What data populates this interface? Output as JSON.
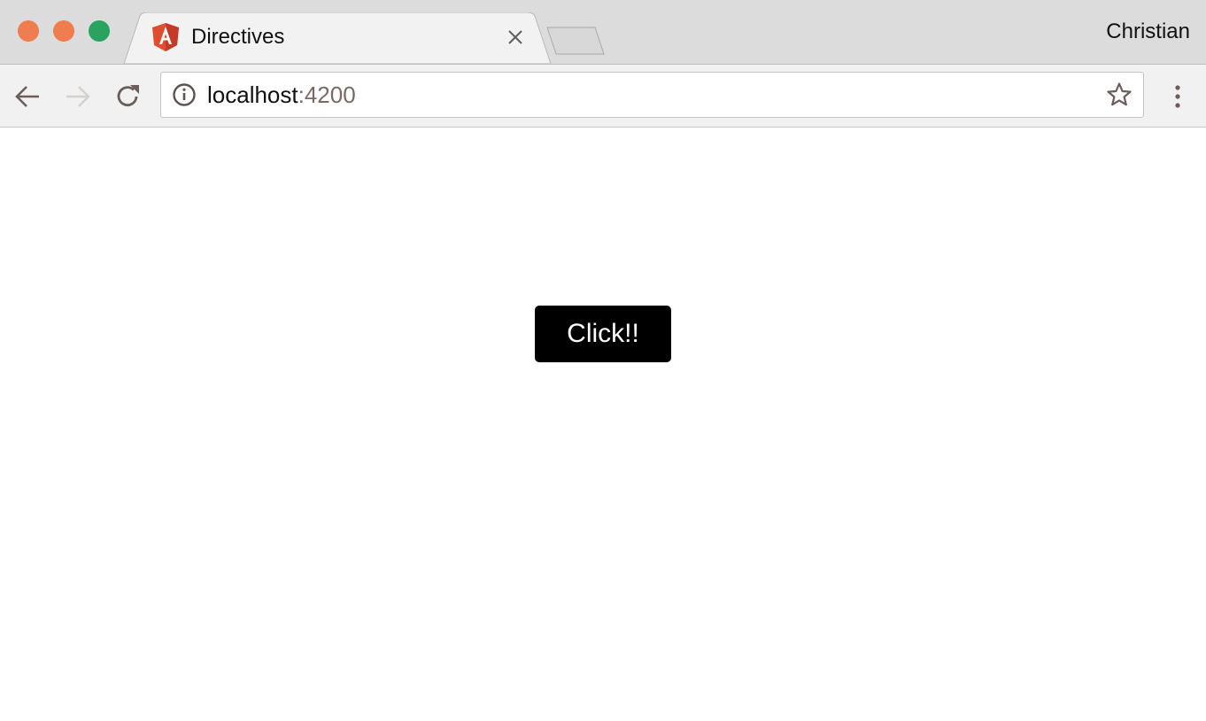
{
  "browser": {
    "window_controls": {
      "close": "close-window",
      "minimize": "minimize-window",
      "maximize": "maximize-window"
    },
    "tab": {
      "title": "Directives",
      "favicon": "angular-icon",
      "close_icon": "close-icon"
    },
    "new_tab_icon": "new-tab-icon",
    "profile_name": "Christian",
    "toolbar": {
      "back_icon": "back-arrow-icon",
      "forward_icon": "forward-arrow-icon",
      "reload_icon": "reload-icon",
      "info_icon": "info-icon",
      "bookmark_icon": "star-icon",
      "menu_icon": "kebab-menu-icon"
    },
    "omnibox": {
      "host": "localhost",
      "port": ":4200"
    }
  },
  "page": {
    "button_label": "Click!!"
  },
  "colors": {
    "tabstrip_bg": "#dcdcdc",
    "toolbar_bg": "#f1f1f1",
    "traffic_close": "#ef7d50",
    "traffic_minimize": "#ef7d50",
    "traffic_maximize": "#2aa35f",
    "angular_red": "#dd4f2e",
    "button_bg": "#000000",
    "button_text": "#ffffff"
  }
}
